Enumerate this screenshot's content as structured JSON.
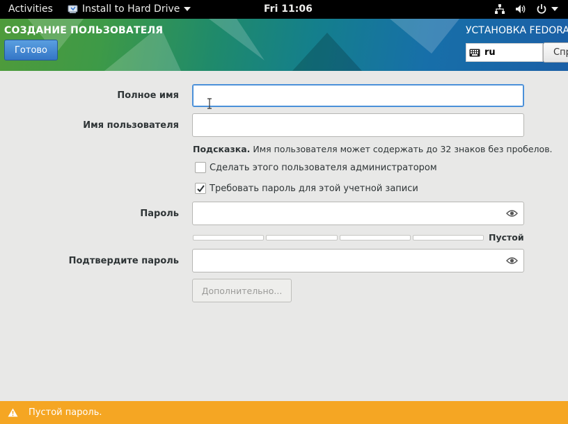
{
  "topbar": {
    "activities": "Activities",
    "app_menu": "Install to Hard Drive",
    "clock": "Fri 11:06",
    "icons": [
      "network-icon",
      "volume-icon",
      "power-icon"
    ]
  },
  "header": {
    "spoke_title": "СОЗДАНИЕ ПОЛЬЗОВАТЕЛЯ",
    "done_label": "Готово",
    "product_title": "УСТАНОВКА FEDORA",
    "keyboard_layout": "ru",
    "help_label": "Справка",
    "colors": {
      "gradient_start": "#4f9b3b",
      "gradient_end": "#1b5fa6",
      "done_button": "#3476c6"
    }
  },
  "form": {
    "full_name": {
      "label": "Полное имя",
      "value": ""
    },
    "username": {
      "label": "Имя пользователя",
      "value": ""
    },
    "hint_bold": "Подсказка.",
    "hint_text": " Имя пользователя может содержать до 32 знаков без пробелов.",
    "admin_checkbox": {
      "label": "Сделать этого пользователя администратором",
      "checked": false
    },
    "require_password_checkbox": {
      "label": "Требовать пароль для этой учетной записи",
      "checked": true
    },
    "password": {
      "label": "Пароль",
      "value": ""
    },
    "strength_label": "Пустой",
    "confirm_password": {
      "label": "Подтвердите пароль",
      "value": ""
    },
    "advanced_label": "Дополнительно..."
  },
  "warning": {
    "text": "Пустой пароль.",
    "color": "#f5a623"
  }
}
